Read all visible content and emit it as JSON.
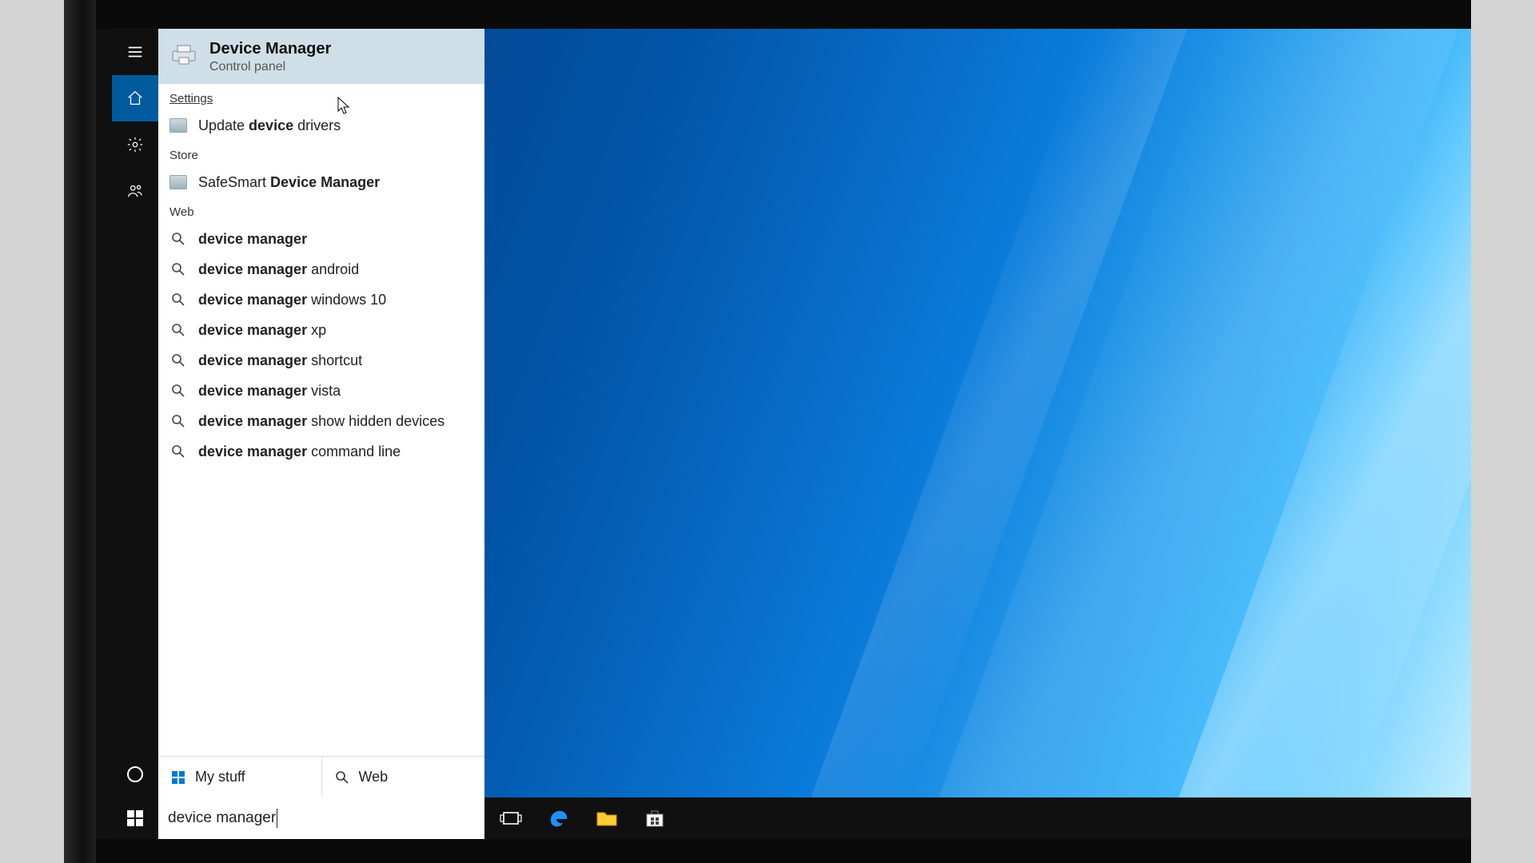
{
  "best_match": {
    "title": "Device Manager",
    "subtitle": "Control panel"
  },
  "sections": {
    "settings_label": "Settings",
    "store_label": "Store",
    "web_label": "Web"
  },
  "settings": {
    "item0_pre": "Update ",
    "item0_bold": "device",
    "item0_post": " drivers"
  },
  "store": {
    "item0_pre": "SafeSmart ",
    "item0_bold": "Device Manager",
    "item0_post": ""
  },
  "web_results": [
    {
      "bold": "device manager",
      "rest": ""
    },
    {
      "bold": "device manager",
      "rest": " android"
    },
    {
      "bold": "device manager",
      "rest": " windows 10"
    },
    {
      "bold": "device manager",
      "rest": " xp"
    },
    {
      "bold": "device manager",
      "rest": " shortcut"
    },
    {
      "bold": "device manager",
      "rest": " vista"
    },
    {
      "bold": "device manager",
      "rest": " show hidden devices"
    },
    {
      "bold": "device manager",
      "rest": " command line"
    }
  ],
  "filters": {
    "mystuff": "My stuff",
    "web": "Web"
  },
  "search": {
    "value": "device manager"
  }
}
